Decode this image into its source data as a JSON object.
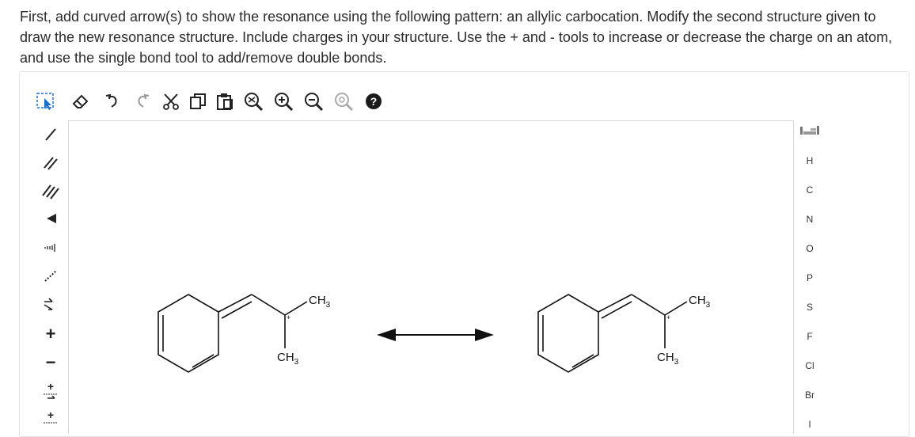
{
  "question": {
    "text": "First, add curved arrow(s) to show the resonance using the following pattern: an allylic carbocation. Modify the second structure given to draw the new resonance structure. Include charges in your structure. Use the + and - tools to increase or decrease the charge on an atom, and use the single bond tool to add/remove double bonds."
  },
  "toolbar": {
    "icons": [
      "select-icon",
      "eraser-icon",
      "undo-icon",
      "redo-icon",
      "cut-icon",
      "copy-icon",
      "paste-icon",
      "zoom-reset-icon",
      "zoom-in-icon",
      "zoom-out-icon",
      "clean-icon",
      "help-icon"
    ]
  },
  "left_tools": {
    "icons": [
      "single-bond-icon",
      "double-bond-icon",
      "triple-bond-icon",
      "wedge-bond-icon",
      "hash-bond-icon",
      "dashed-bond-icon",
      "arrow-mechanism-icon",
      "positive-charge-icon",
      "negative-charge-icon",
      "lone-pair-plus-icon",
      "radical-plus-icon"
    ],
    "labels": {
      "plus": "+",
      "minus": "−"
    }
  },
  "elements": {
    "periodic_icon": "periodic-table-icon",
    "symbols": [
      "H",
      "C",
      "N",
      "O",
      "P",
      "S",
      "F",
      "Cl",
      "Br",
      "I"
    ]
  },
  "molecules": {
    "ch3": "CH",
    "subscript": "3",
    "charge": "+"
  }
}
